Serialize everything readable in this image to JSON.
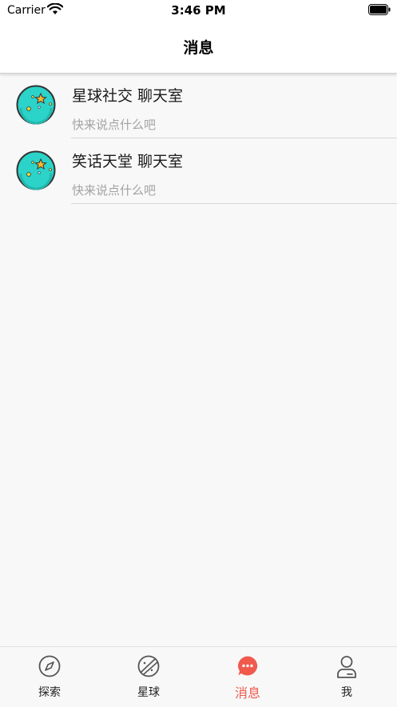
{
  "status_bar": {
    "carrier": "Carrier",
    "time": "3:46 PM"
  },
  "nav": {
    "title": "消息"
  },
  "chats": [
    {
      "title": "星球社交 聊天室",
      "subtitle": "快来说点什么吧",
      "icon": "planet-avatar-icon"
    },
    {
      "title": "笑话天堂 聊天室",
      "subtitle": "快来说点什么吧",
      "icon": "planet-avatar-icon"
    }
  ],
  "tabs": [
    {
      "label": "探索",
      "icon": "compass-icon",
      "active": false
    },
    {
      "label": "星球",
      "icon": "planet-icon",
      "active": false
    },
    {
      "label": "消息",
      "icon": "chat-bubble-icon",
      "active": true
    },
    {
      "label": "我",
      "icon": "person-icon",
      "active": false
    }
  ],
  "colors": {
    "accent": "#f0594c",
    "avatar_fill": "#2bd3c9",
    "background": "#f8f8f8"
  }
}
